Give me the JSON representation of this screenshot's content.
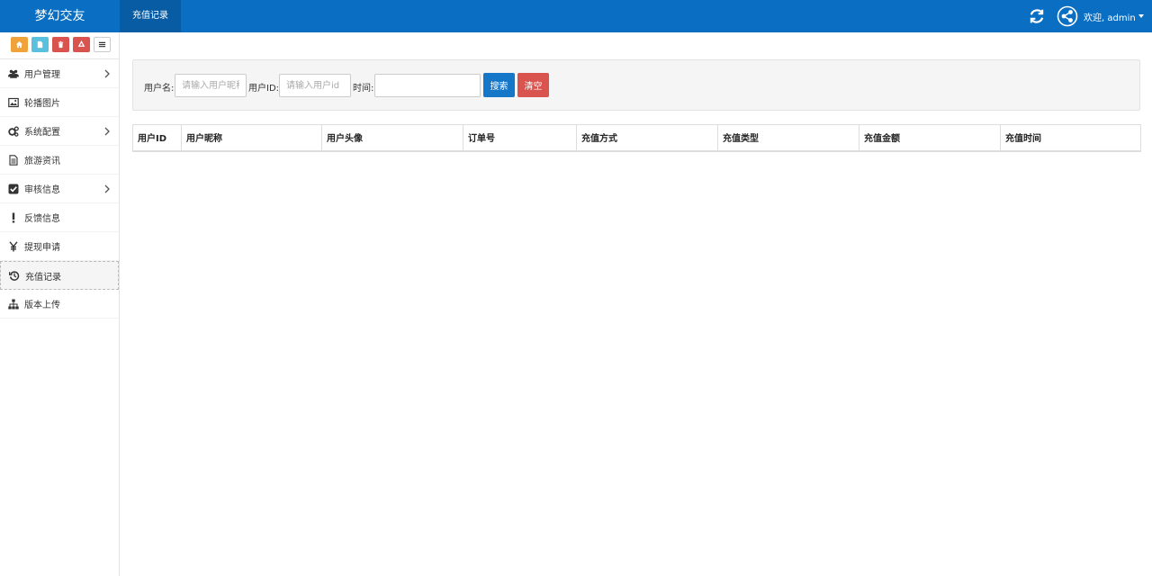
{
  "app": {
    "brand": "梦幻交友",
    "current_tab": "充值记录",
    "welcome": "欢迎, admin"
  },
  "colors": {
    "navbar": "#0a6fc2",
    "primary": "#1677c9",
    "danger": "#d9534f",
    "shortcut_home": "#f0a33a",
    "shortcut_doc": "#5bc0de",
    "shortcut_trash": "#d9534f",
    "shortcut_recycle": "#d9534f"
  },
  "shortcuts": [
    {
      "icon": "home-icon"
    },
    {
      "icon": "document-icon"
    },
    {
      "icon": "trash-icon"
    },
    {
      "icon": "recycle-icon"
    },
    {
      "icon": "list-icon"
    }
  ],
  "sidebar": {
    "items": [
      {
        "label": "用户管理",
        "icon": "users-icon",
        "has_children": true
      },
      {
        "label": "轮播图片",
        "icon": "image-icon",
        "has_children": false
      },
      {
        "label": "系统配置",
        "icon": "cogs-icon",
        "has_children": true
      },
      {
        "label": "旅游资讯",
        "icon": "file-text-icon",
        "has_children": false
      },
      {
        "label": "审核信息",
        "icon": "check-square-icon",
        "has_children": true
      },
      {
        "label": "反馈信息",
        "icon": "exclamation-icon",
        "has_children": false
      },
      {
        "label": "提现申请",
        "icon": "yen-icon",
        "has_children": false
      },
      {
        "label": "充值记录",
        "icon": "history-icon",
        "has_children": false,
        "active": true
      },
      {
        "label": "版本上传",
        "icon": "sitemap-icon",
        "has_children": false
      }
    ]
  },
  "filter": {
    "username_label": "用户名:",
    "username_placeholder": "请输入用户昵称",
    "userid_label": "用户ID:",
    "userid_placeholder": "请输入用户id",
    "time_label": "时间:",
    "time_value": "",
    "search_button": "搜索",
    "clear_button": "清空"
  },
  "table": {
    "columns": [
      "用户ID",
      "用户昵称",
      "用户头像",
      "订单号",
      "充值方式",
      "充值类型",
      "充值金额",
      "充值时间"
    ],
    "rows": []
  }
}
